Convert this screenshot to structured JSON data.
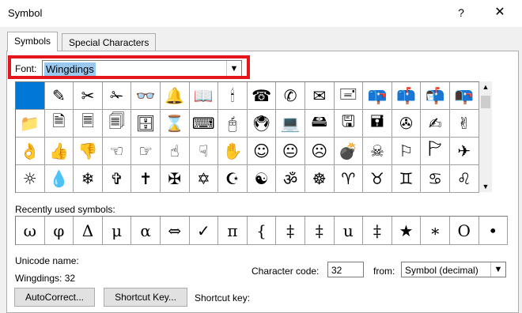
{
  "window": {
    "title": "Symbol",
    "help": "?",
    "close": "✕"
  },
  "tabs": [
    {
      "label": "Symbols",
      "active": true
    },
    {
      "label": "Special Characters",
      "active": false
    }
  ],
  "font": {
    "label": "Font:",
    "value": "Wingdings"
  },
  "symbol_grid": [
    [
      "",
      "✎",
      "✂",
      "✁",
      "👓",
      "🔔",
      "📖",
      "🕯",
      "☎",
      "✆",
      "✉",
      "🖃",
      "📪",
      "📫",
      "📬",
      "📭"
    ],
    [
      "📁",
      "🗎",
      "🗏",
      "🗐",
      "🗄",
      "⌛",
      "⌨",
      "🖰",
      "🖲",
      "💻",
      "🖴",
      "🖫",
      "🖬",
      "✇",
      "✍",
      "✌"
    ],
    [
      "👌",
      "👍",
      "👎",
      "☜",
      "☞",
      "☝",
      "☟",
      "✋",
      "☺",
      "😐",
      "☹",
      "💣",
      "☠",
      "⚐",
      "🏱",
      "✈"
    ],
    [
      "☼",
      "💧",
      "❄",
      "✞",
      "✝",
      "✠",
      "✡",
      "☪",
      "☯",
      "ॐ",
      "☸",
      "♈",
      "♉",
      "♊",
      "♋",
      "♌"
    ]
  ],
  "recently_used": {
    "label": "Recently used symbols:",
    "symbols": [
      "ω",
      "φ",
      "Δ",
      "μ",
      "α",
      "⇔",
      "✓",
      "π",
      "{",
      "‡",
      "‡",
      "u",
      "‡",
      "★",
      "∗",
      "O",
      "•"
    ]
  },
  "unicode_name": {
    "label": "Unicode name:",
    "value": "Wingdings: 32"
  },
  "character_code": {
    "label": "Character code:",
    "value": "32"
  },
  "from": {
    "label": "from:",
    "value": "Symbol (decimal)"
  },
  "buttons": {
    "autocorrect": "AutoCorrect...",
    "shortcut_key": "Shortcut Key...",
    "shortcut_key_label": "Shortcut key:"
  }
}
